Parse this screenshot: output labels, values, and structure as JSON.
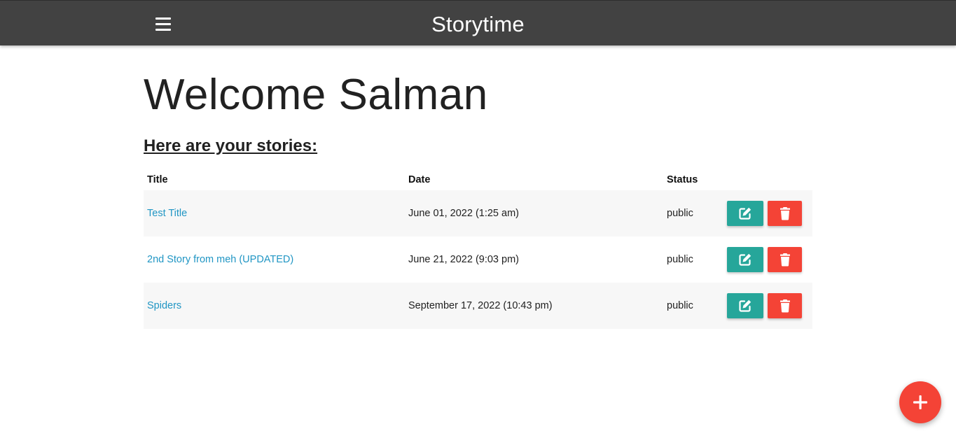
{
  "navbar": {
    "brand": "Storytime",
    "menu_icon": "hamburger-menu-icon",
    "background": "#424242"
  },
  "main": {
    "title": "Welcome Salman",
    "subtitle": "Here are your stories:"
  },
  "table": {
    "headers": [
      "Title",
      "Date",
      "Status"
    ],
    "rows": [
      {
        "title": "Test Title",
        "date": "June 01, 2022 (1:25 am)",
        "status": "public"
      },
      {
        "title": "2nd Story from meh (UPDATED)",
        "date": "June 21, 2022 (9:03 pm)",
        "status": "public"
      },
      {
        "title": "Spiders",
        "date": "September 17, 2022 (10:43 pm)",
        "status": "public"
      }
    ],
    "edit_icon": "edit-icon",
    "delete_icon": "trash-icon"
  },
  "fab": {
    "icon": "plus-icon",
    "color": "#f44336"
  },
  "colors": {
    "link": "#2196c4",
    "edit": "#26a69a",
    "delete": "#f44336"
  }
}
